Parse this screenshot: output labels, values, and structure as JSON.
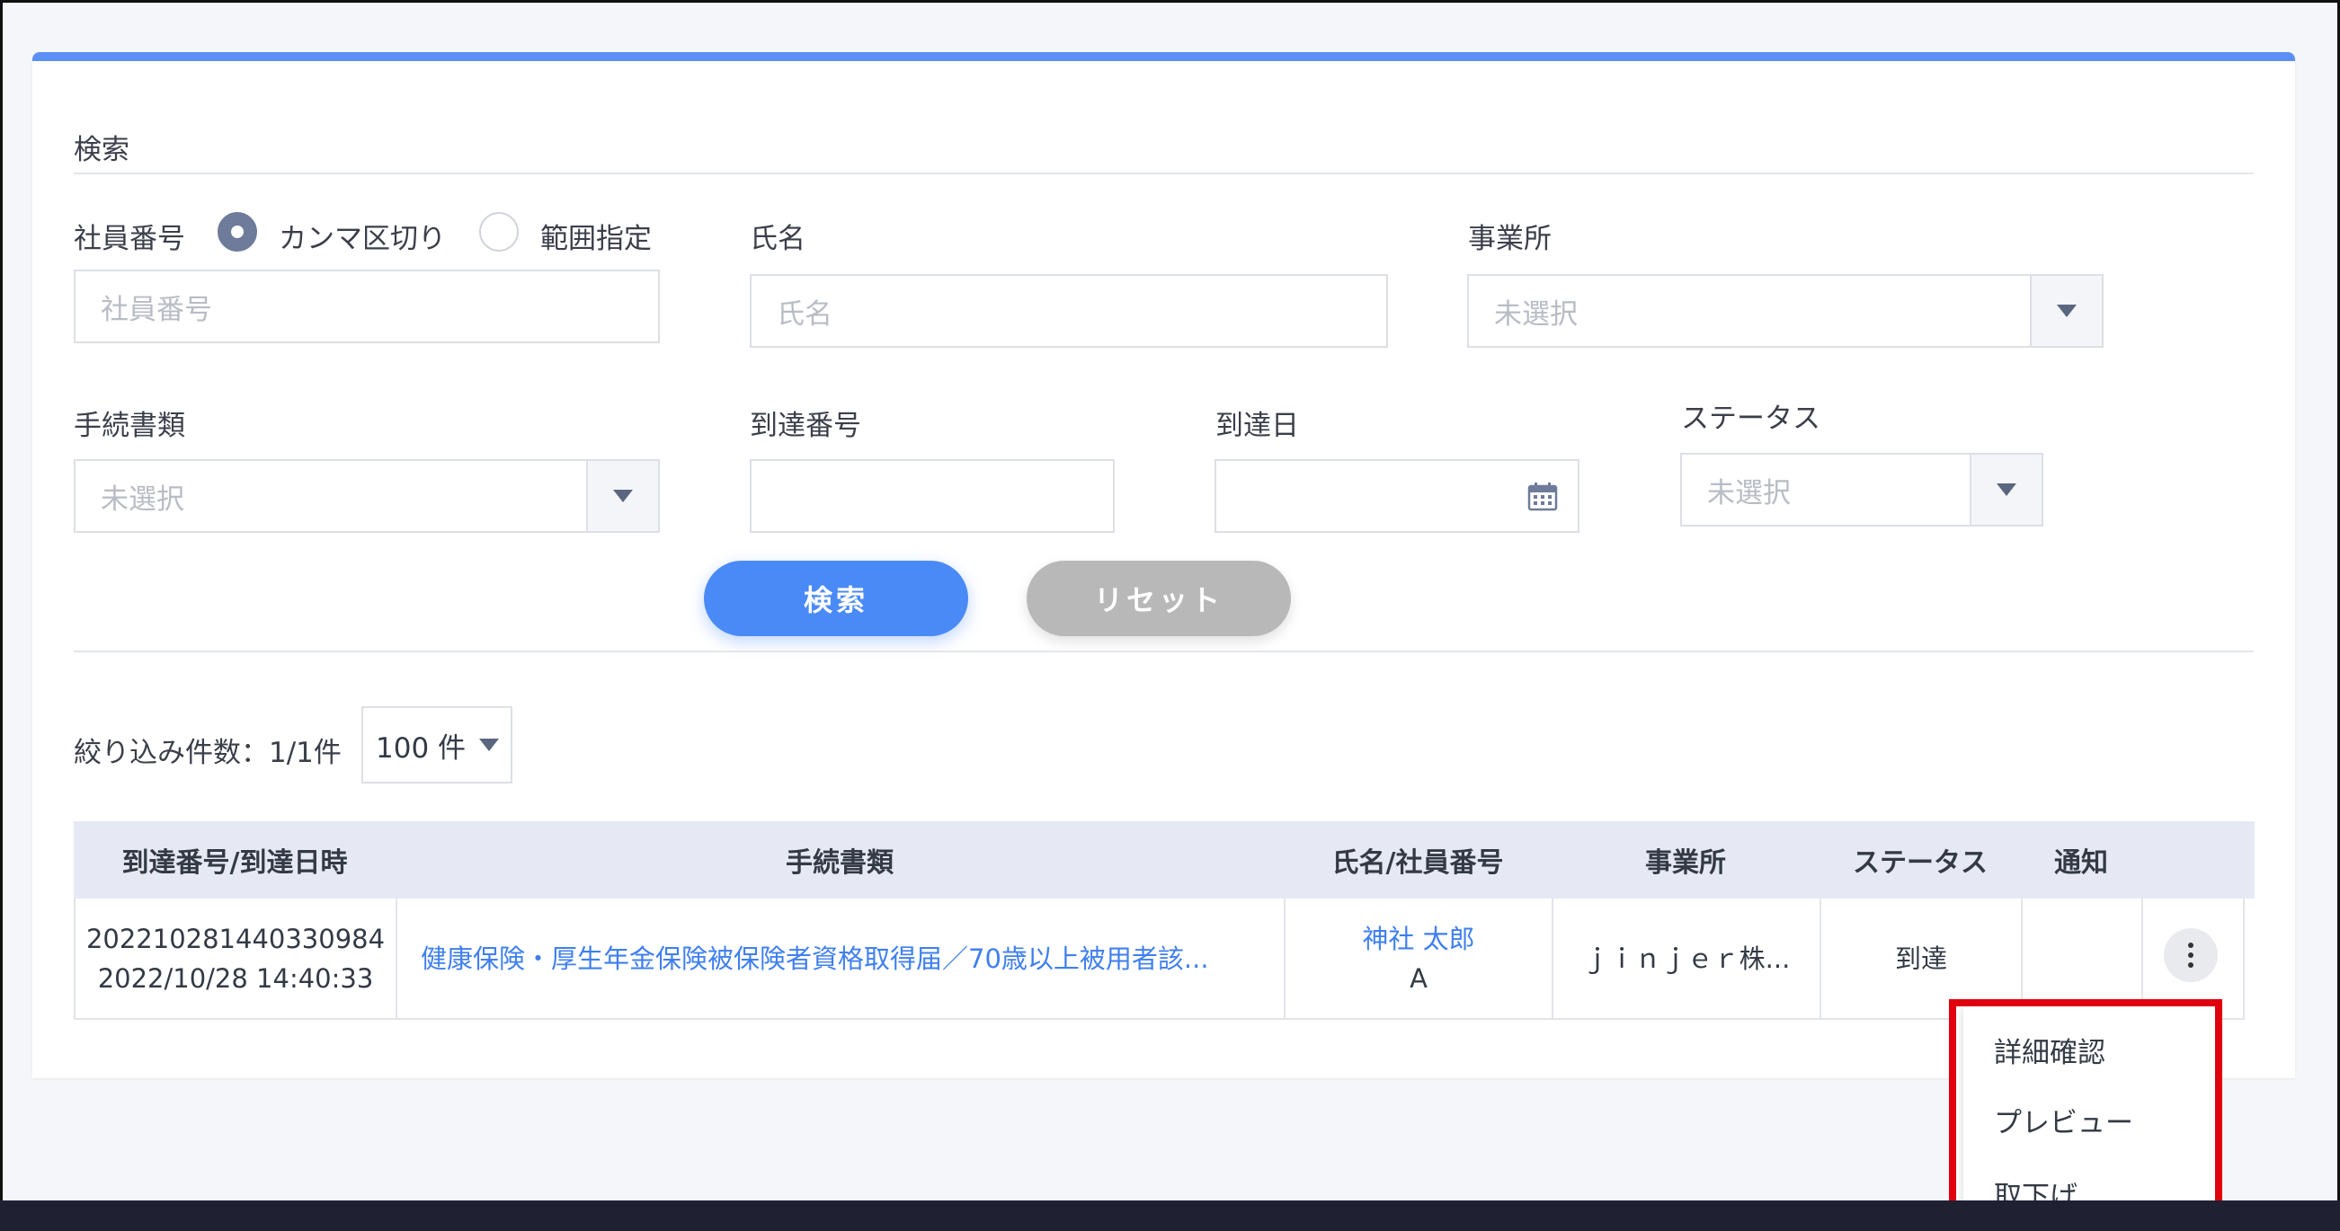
{
  "search": {
    "section_title": "検索",
    "employee_number": {
      "label": "社員番号",
      "radio_comma": "カンマ区切り",
      "radio_range": "範囲指定",
      "placeholder": "社員番号"
    },
    "name": {
      "label": "氏名",
      "placeholder": "氏名"
    },
    "office": {
      "label": "事業所",
      "placeholder": "未選択"
    },
    "document": {
      "label": "手続書類",
      "placeholder": "未選択"
    },
    "arrival_number": {
      "label": "到達番号",
      "value": ""
    },
    "arrival_date": {
      "label": "到達日",
      "value": ""
    },
    "status": {
      "label": "ステータス",
      "placeholder": "未選択"
    },
    "search_button": "検索",
    "reset_button": "リセット"
  },
  "results": {
    "count_label": "絞り込み件数：1/1件",
    "page_size": "100 件",
    "columns": [
      "到達番号/到達日時",
      "手続書類",
      "氏名/社員番号",
      "事業所",
      "ステータス",
      "通知"
    ],
    "rows": [
      {
        "arrival_number": "202210281440330984",
        "arrival_datetime": "2022/10/28 14:40:33",
        "document": "健康保険・厚生年金保険被保険者資格取得届／70歳以上被用者該...",
        "name": "神社 太郎",
        "employee_number": "A",
        "office": "ｊｉｎｊｅｒ株...",
        "status": "到達",
        "notice": ""
      }
    ]
  },
  "context_menu": {
    "items": [
      "詳細確認",
      "プレビュー",
      "取下げ"
    ],
    "highlight_color": "#e2000e"
  },
  "colors": {
    "accent": "#4a8af6",
    "link": "#3f7ff0",
    "panel_top_border": "#5b8ff5",
    "reset": "#b8b8b8"
  }
}
